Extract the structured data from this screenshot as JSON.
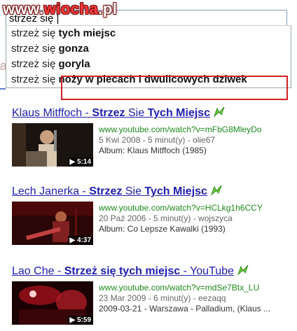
{
  "watermark": {
    "prefix": "www.",
    "name": "wiocha",
    "suffix": ".pl"
  },
  "search": {
    "value": "strzeż się |"
  },
  "side_letter": "a",
  "suggestions": [
    {
      "prefix": "strzeż się ",
      "bold": "tych miejsc"
    },
    {
      "prefix": "strzeż się ",
      "bold": "gonza"
    },
    {
      "prefix": "strzeż się ",
      "bold": "goryla"
    },
    {
      "prefix": "strzeż się ",
      "bold": "noży w plecach i dwulicowych dziwek"
    }
  ],
  "results": [
    {
      "title_pre": "Klaus Mitffoch - ",
      "title_b1": "Strzez",
      "title_mid": " Sie ",
      "title_b2": "Tych Miejsc",
      "title_post": "",
      "url": "www.youtube.com/watch?v=mFbG8MleyDo",
      "date_line": "5 Kwi 2008 - 5 minut(y) - olie67",
      "album_line": "Album: Klaus Mitffoch (1985)",
      "duration": "5:14"
    },
    {
      "title_pre": "Lech Janerka - ",
      "title_b1": "Strzez",
      "title_mid": " Sie ",
      "title_b2": "Tych Miejsc",
      "title_post": "",
      "url": "www.youtube.com/watch?v=HCLkg1h6CCY",
      "date_line": "20 Paź 2006 - 5 minut(y) - wojszyca",
      "album_line": "Album: Co Lepsze Kawalki (1993)",
      "duration": "4:37"
    },
    {
      "title_pre": "Lao Che - ",
      "title_b1": "Strzeż się tych miejsc",
      "title_mid": "",
      "title_b2": "",
      "title_post": " - YouTube",
      "url": "www.youtube.com/watch?v=mdSe7Btx_LU",
      "date_line": "23 Mar 2009 - 6 minut(y) - eezaqq",
      "album_line": "2009-03-21 - Warszawa - Palladium, (Klaus ...",
      "duration": "5:59"
    }
  ],
  "colors": {
    "link": "#2020b0",
    "url": "#1b8a1b",
    "highlight_box": "#d42020"
  }
}
